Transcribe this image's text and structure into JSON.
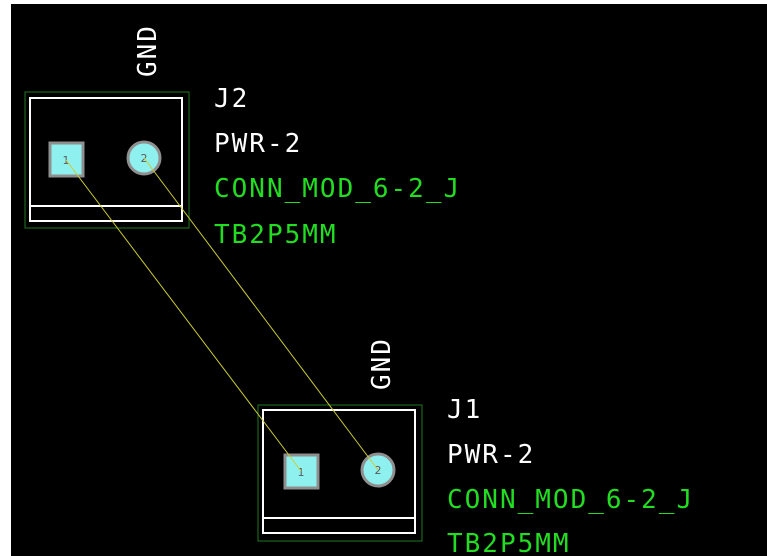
{
  "colors": {
    "board_bg": "#000000",
    "outline": "#ffffff",
    "courtyard": "#1f7a1f",
    "ref_text": "#ffffff",
    "value_text": "#ffffff",
    "green_text": "#22dd22",
    "ratsnest": "#cccc33",
    "pad_fill": "#8ff0f0",
    "pad_border": "#8f8f8f"
  },
  "components": {
    "j2": {
      "net_label": "GND",
      "reference": "J2",
      "value": "PWR-2",
      "part": "CONN_MOD_6-2_J",
      "footprint": "TB2P5MM",
      "pad1": "1",
      "pad2": "2"
    },
    "j1": {
      "net_label": "GND",
      "reference": "J1",
      "value": "PWR-2",
      "part": "CONN_MOD_6-2_J",
      "footprint": "TB2P5MM",
      "pad1": "1",
      "pad2": "2"
    }
  },
  "ratsnest": {
    "icon": "ratsnest-line"
  }
}
